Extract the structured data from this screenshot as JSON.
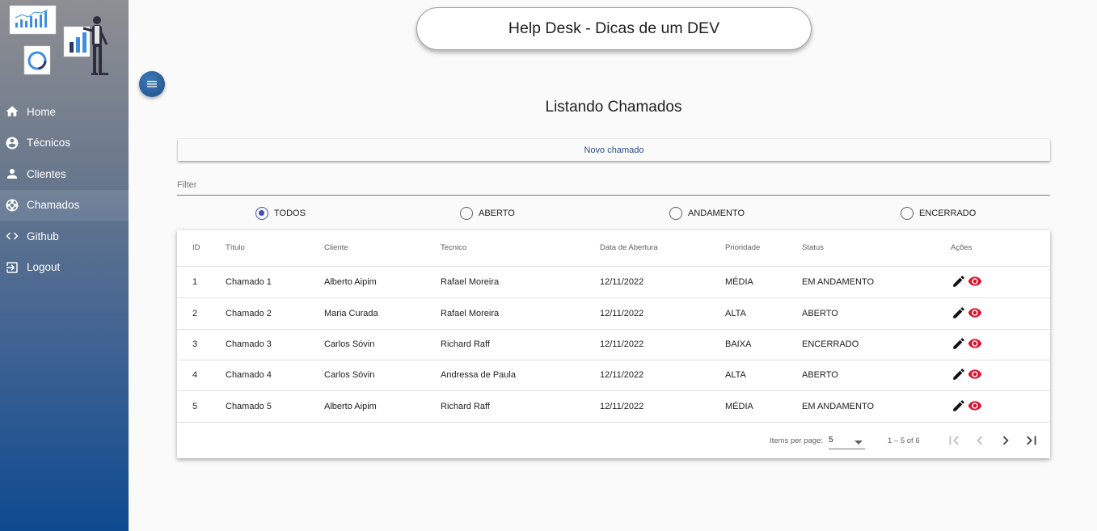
{
  "app_title": "Help Desk - Dicas de um DEV",
  "page_title": "Listando Chamados",
  "sidebar": {
    "items": [
      {
        "label": "Home",
        "icon": "home-icon"
      },
      {
        "label": "Técnicos",
        "icon": "account-circle-icon"
      },
      {
        "label": "Clientes",
        "icon": "person-icon"
      },
      {
        "label": "Chamados",
        "icon": "support-icon"
      },
      {
        "label": "Github",
        "icon": "code-icon"
      },
      {
        "label": "Logout",
        "icon": "logout-icon"
      }
    ]
  },
  "new_button_label": "Novo chamado",
  "filter": {
    "placeholder": "Filter"
  },
  "status_filters": [
    {
      "label": "TODOS",
      "checked": true
    },
    {
      "label": "ABERTO",
      "checked": false
    },
    {
      "label": "ANDAMENTO",
      "checked": false
    },
    {
      "label": "ENCERRADO",
      "checked": false
    }
  ],
  "table": {
    "columns": [
      "ID",
      "Título",
      "Cliente",
      "Tecnico",
      "Data de Abertura",
      "Prioridade",
      "Status",
      "Ações"
    ],
    "rows": [
      [
        "1",
        "Chamado 1",
        "Alberto Aipim",
        "Rafael Moreira",
        "12/11/2022",
        "MÉDIA",
        "EM ANDAMENTO"
      ],
      [
        "2",
        "Chamado 2",
        "Maria Curada",
        "Rafael Moreira",
        "12/11/2022",
        "ALTA",
        "ABERTO"
      ],
      [
        "3",
        "Chamado 3",
        "Carlos Sóvin",
        "Richard Raff",
        "12/11/2022",
        "BAIXA",
        "ENCERRADO"
      ],
      [
        "4",
        "Chamado 4",
        "Carlos Sóvin",
        "Andressa de Paula",
        "12/11/2022",
        "ALTA",
        "ABERTO"
      ],
      [
        "5",
        "Chamado 5",
        "Alberto Aipim",
        "Richard Raff",
        "12/11/2022",
        "MÉDIA",
        "EM ANDAMENTO"
      ]
    ]
  },
  "paginator": {
    "items_per_page_label": "Items per page:",
    "page_size": "5",
    "range_label": "1 – 5 of 6"
  },
  "colors": {
    "accent": "#3f51b5",
    "view_icon": "#e0102a",
    "sidebar_bottom": "#0d4a8f"
  }
}
